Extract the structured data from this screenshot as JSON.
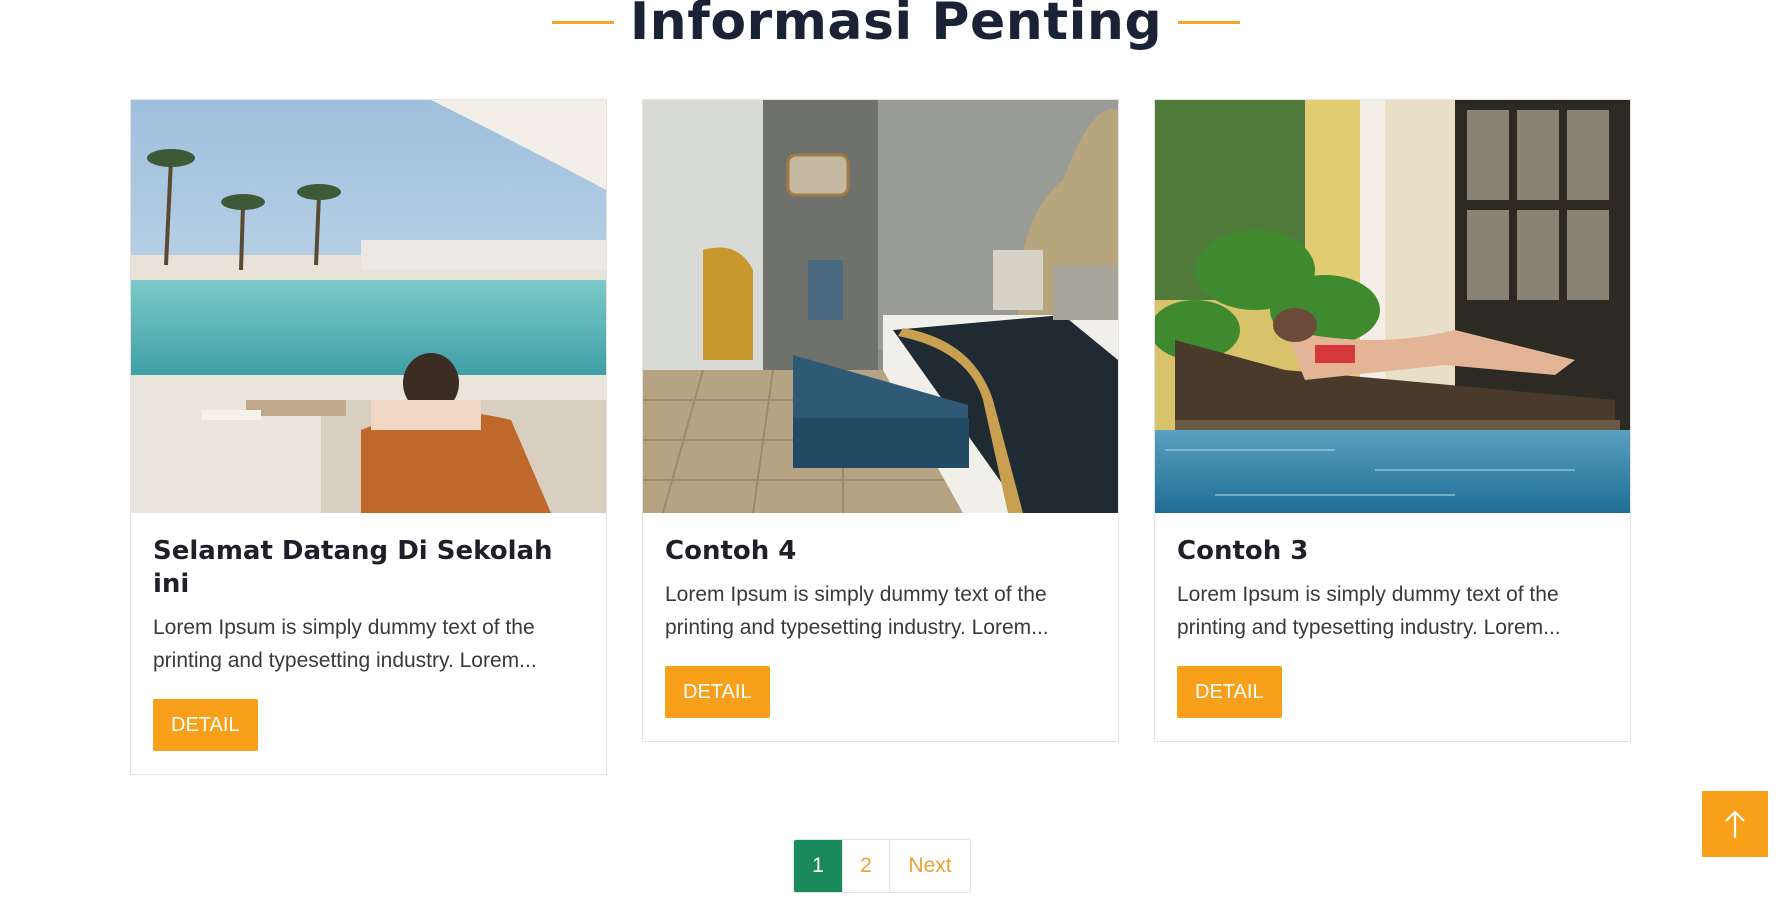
{
  "section": {
    "title": "Informasi Penting"
  },
  "cards": [
    {
      "title": "Selamat Datang Di Sekolah ini",
      "excerpt": "Lorem Ipsum is simply dummy text of the printing and typesetting industry. Lorem...",
      "button_label": "DETAIL",
      "image_subject": "resort pool with palm trees and woman on lounger"
    },
    {
      "title": "Contoh 4",
      "excerpt": "Lorem Ipsum is simply dummy text of the printing and typesetting industry. Lorem...",
      "button_label": "DETAIL",
      "image_subject": "hotel bedroom with bench and chairs"
    },
    {
      "title": "Contoh 3",
      "excerpt": "Lorem Ipsum is simply dummy text of the printing and typesetting industry. Lorem...",
      "button_label": "DETAIL",
      "image_subject": "poolside lounger with woman relaxing"
    }
  ],
  "pagination": {
    "current": "1",
    "page_2": "2",
    "next_label": "Next"
  },
  "back_to_top": {
    "icon": "arrow-up-icon"
  },
  "colors": {
    "accent": "#f9a01b",
    "heading": "#1a2336",
    "pagination_active": "#1a8a5a"
  }
}
